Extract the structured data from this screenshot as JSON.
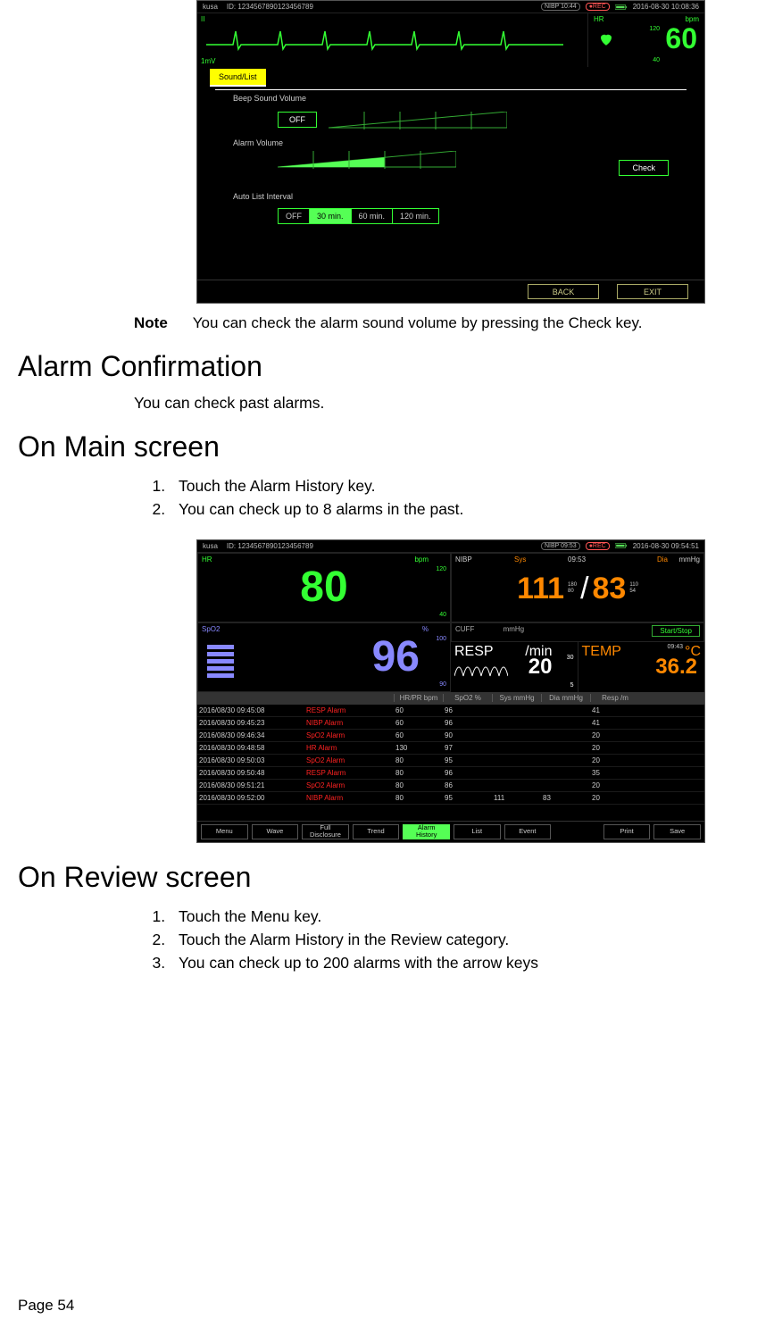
{
  "screenshot1": {
    "header": {
      "name": "kusa",
      "id_label": "ID: 1234567890123456789",
      "badge1": "NIBP 10:44",
      "badge2": "●REC",
      "datetime": "2016-08-30  10:08:36"
    },
    "ecg": {
      "lead": "II",
      "scale": "1mV"
    },
    "hr": {
      "label": "HR",
      "unit": "bpm",
      "value": "60",
      "hi": "120",
      "lo": "40"
    },
    "tab": "Sound/List",
    "beep_label": "Beep Sound Volume",
    "off_btn": "OFF",
    "alarm_vol_label": "Alarm Volume",
    "check_btn": "Check",
    "auto_list_label": "Auto List Interval",
    "intervals": {
      "off": "OFF",
      "i30": "30 min.",
      "i60": "60 min.",
      "i120": "120 min."
    },
    "footer": {
      "back": "BACK",
      "exit": "EXIT"
    }
  },
  "note": {
    "label": "Note",
    "text": "You can check the alarm sound volume by pressing the Check key."
  },
  "h1": "Alarm Confirmation",
  "p1": "You can check past alarms.",
  "h2": "On Main screen",
  "main_list": {
    "i1": "Touch the Alarm History key.",
    "i2": "You can check up to 8 alarms in the past."
  },
  "screenshot2": {
    "header": {
      "name": "kusa",
      "id_label": "ID: 1234567890123456789",
      "badge1": "NIBP 09:53",
      "badge2": "●REC",
      "datetime": "2016-08-30 09:54:51"
    },
    "hr": {
      "label": "HR",
      "unit": "bpm",
      "value": "80",
      "hi": "120",
      "lo": "40"
    },
    "nibp": {
      "label": "NIBP",
      "sys_label": "Sys",
      "dia_label": "Dia",
      "unit": "mmHg",
      "time": "09:53",
      "sys": "111",
      "dia": "83",
      "sys_hi": "180",
      "sys_lo": "80",
      "dia_hi": "110",
      "dia_lo": "54"
    },
    "spo2": {
      "label": "SpO2",
      "unit": "%",
      "value": "96",
      "hi": "100",
      "lo": "90"
    },
    "cuff": {
      "label": "CUFF",
      "unit": "mmHg",
      "btn": "Start/Stop"
    },
    "resp": {
      "label": "RESP",
      "unit": "/min",
      "value": "20",
      "hi": "30",
      "lo": "5"
    },
    "temp": {
      "label": "TEMP",
      "time": "09:43",
      "unit": "°C",
      "value": "36.2"
    },
    "th": {
      "hr": "HR/PR bpm",
      "spo2": "SpO2 %",
      "sys": "Sys mmHg",
      "dia": "Dia mmHg",
      "resp": "Resp /m"
    },
    "rows": [
      {
        "t": "2016/08/30 09:45:08",
        "a": "RESP Alarm",
        "c1": "60",
        "c2": "96",
        "c3": "",
        "c4": "",
        "c5": "41"
      },
      {
        "t": "2016/08/30 09:45:23",
        "a": "NIBP Alarm",
        "c1": "60",
        "c2": "96",
        "c3": "",
        "c4": "",
        "c5": "41"
      },
      {
        "t": "2016/08/30 09:46:34",
        "a": "SpO2 Alarm",
        "c1": "60",
        "c2": "90",
        "c3": "",
        "c4": "",
        "c5": "20"
      },
      {
        "t": "2016/08/30 09:48:58",
        "a": "HR Alarm",
        "c1": "130",
        "c2": "97",
        "c3": "",
        "c4": "",
        "c5": "20"
      },
      {
        "t": "2016/08/30 09:50:03",
        "a": "SpO2 Alarm",
        "c1": "80",
        "c2": "95",
        "c3": "",
        "c4": "",
        "c5": "20"
      },
      {
        "t": "2016/08/30 09:50:48",
        "a": "RESP Alarm",
        "c1": "80",
        "c2": "96",
        "c3": "",
        "c4": "",
        "c5": "35"
      },
      {
        "t": "2016/08/30 09:51:21",
        "a": "SpO2 Alarm",
        "c1": "80",
        "c2": "86",
        "c3": "",
        "c4": "",
        "c5": "20"
      },
      {
        "t": "2016/08/30 09:52:00",
        "a": "NIBP Alarm",
        "c1": "80",
        "c2": "95",
        "c3": "111",
        "c4": "83",
        "c5": "20"
      }
    ],
    "nav": {
      "menu": "Menu",
      "wave": "Wave",
      "full": "Full\nDisclosure",
      "trend": "Trend",
      "alarm": "Alarm\nHistory",
      "list": "List",
      "event": "Event",
      "print": "Print",
      "save": "Save"
    }
  },
  "h3": "On Review screen",
  "review_list": {
    "i1": "Touch the Menu key.",
    "i2": "Touch the Alarm History in the Review category.",
    "i3": "You can check up to 200 alarms with the arrow keys"
  },
  "page_num": "Page 54"
}
